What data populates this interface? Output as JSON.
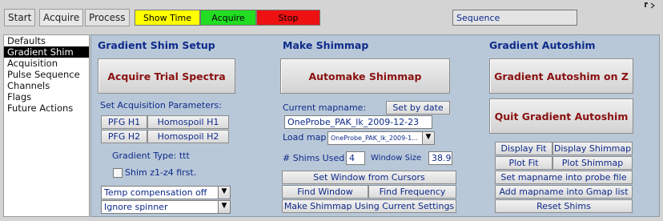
{
  "tabs": [
    "Start",
    "Acquire",
    "Process"
  ],
  "status_buttons": {
    "show_time": {
      "label": "Show Time",
      "color": "#ffff00"
    },
    "acquire": {
      "label": "Acquire",
      "color": "#22dd22"
    },
    "stop": {
      "label": "Stop",
      "color": "#ee1111"
    },
    "sequence": {
      "label": "Sequence",
      "color": "#e4e4e4"
    }
  },
  "pin_icon": "pin-icon",
  "nav": {
    "items": [
      "Defaults",
      "Gradient Shim",
      "Acquisition",
      "Pulse Sequence",
      "Channels",
      "Flags",
      "Future Actions"
    ],
    "selected": "Gradient Shim"
  },
  "setup": {
    "title": "Gradient Shim Setup",
    "acquire_trial": "Acquire Trial Spectra",
    "set_params": "Set Acquisition Parameters:",
    "pfg_h1": "PFG H1",
    "homospoil_h1": "Homospoil H1",
    "pfg_h2": "PFG H2",
    "homospoil_h2": "Homospoil H2",
    "gradient_type": "Gradient Type:  ttt",
    "shim_first": "Shim z1-z4 first.",
    "temp_comp": "Temp compensation off",
    "spinner": "Ignore spinner"
  },
  "make": {
    "title": "Make Shimmap",
    "automake": "Automake Shimmap",
    "current_mapname_label": "Current mapname:",
    "set_by_date": "Set by date",
    "mapname_value": "OneProbe_PAK_lk_2009-12-23",
    "load_map_label": "Load map",
    "load_map_value": "OneProbe_PAK_lk_2009-1...",
    "shims_used_label": "# Shims Used",
    "shims_used_value": "4",
    "window_size_label": "Window Size",
    "window_size_value": "38.9",
    "set_window": "Set Window from Cursors",
    "find_window": "Find Window",
    "find_frequency": "Find Frequency",
    "make_current": "Make Shimmap Using Current Settings"
  },
  "autoshim": {
    "title": "Gradient Autoshim",
    "autoshim_z": "Gradient Autoshim on Z",
    "quit": "Quit Gradient Autoshim",
    "display_fit": "Display Fit",
    "display_shimmap": "Display Shimmap",
    "plot_fit": "Plot Fit",
    "plot_shimmap": "Plot Shimmap",
    "set_mapname_probe": "Set mapname into probe file",
    "add_mapname_gmap": "Add mapname into Gmap list",
    "reset_shims": "Reset Shims"
  }
}
